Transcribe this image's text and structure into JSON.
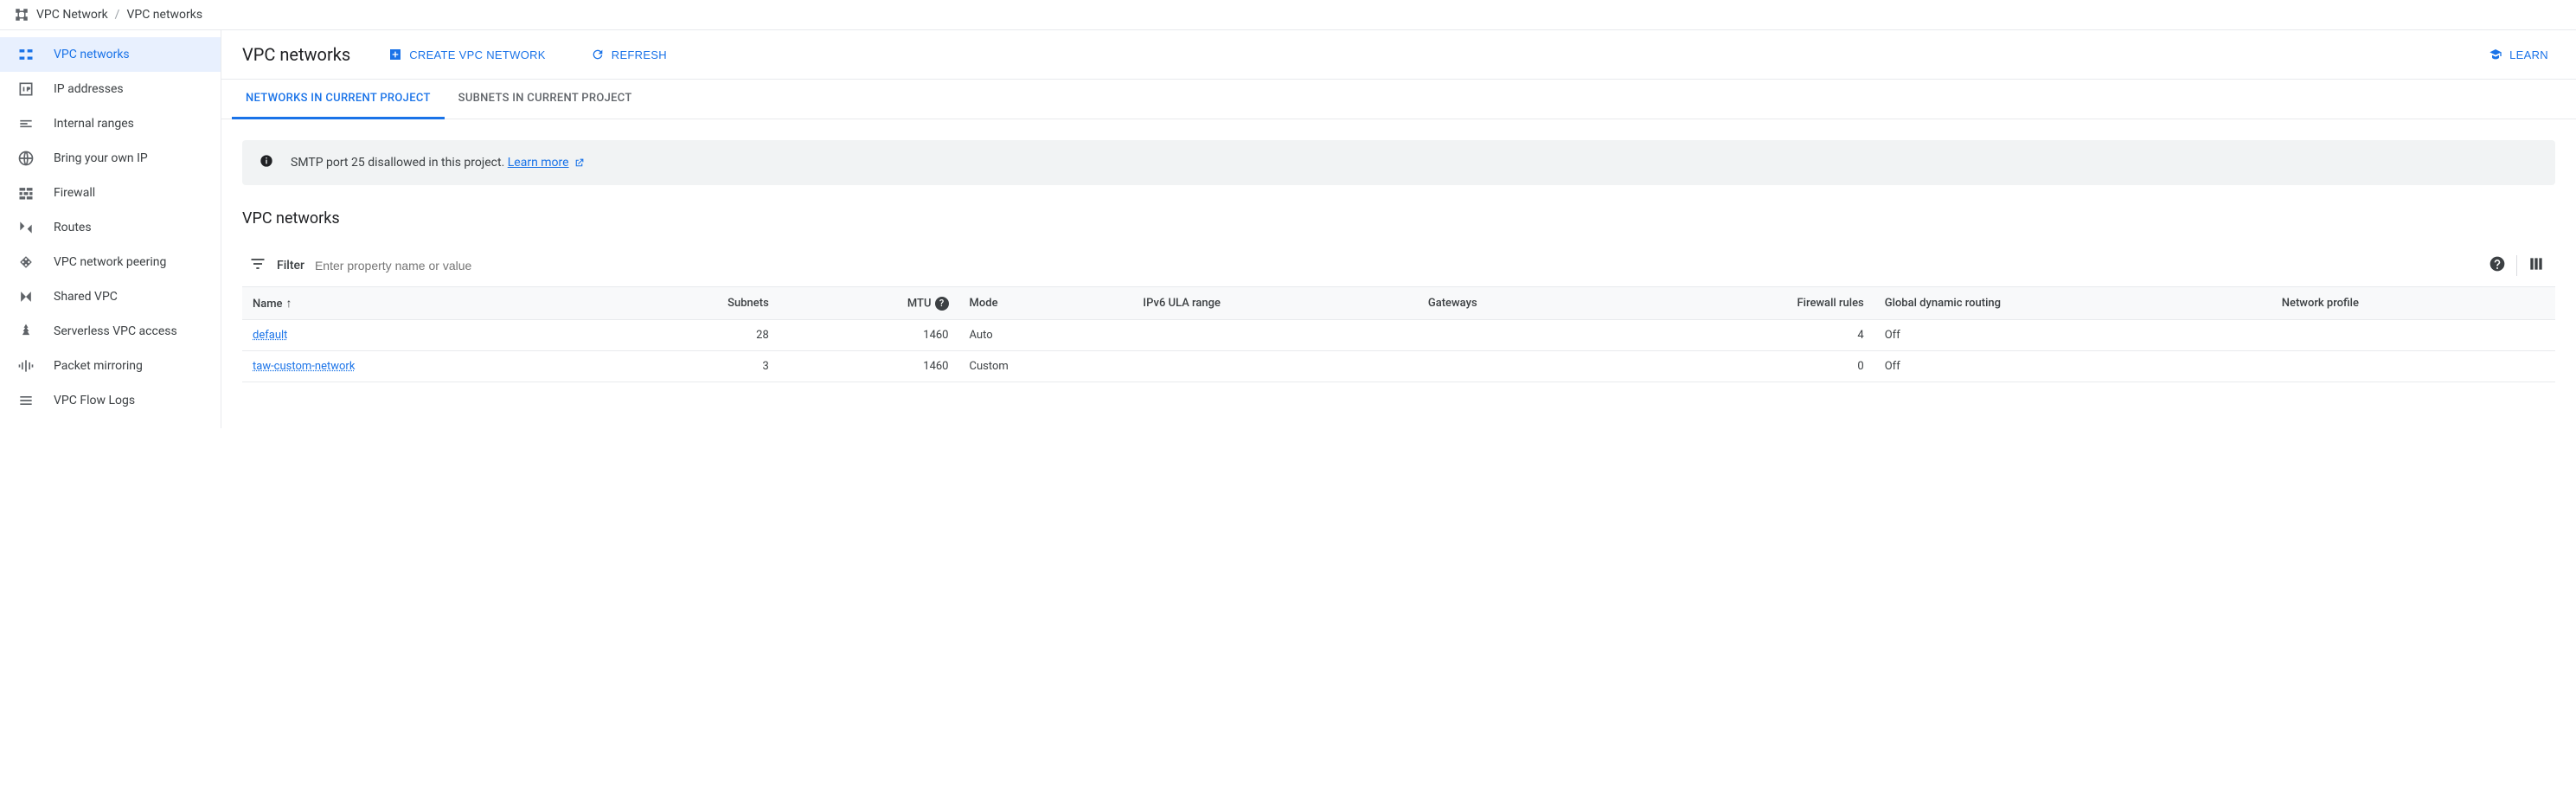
{
  "breadcrumb": {
    "parent": "VPC Network",
    "current": "VPC networks"
  },
  "sidebar": {
    "items": [
      {
        "label": "VPC networks",
        "icon": "vpc-networks-icon",
        "active": true
      },
      {
        "label": "IP addresses",
        "icon": "ip-addresses-icon"
      },
      {
        "label": "Internal ranges",
        "icon": "internal-ranges-icon"
      },
      {
        "label": "Bring your own IP",
        "icon": "globe-icon"
      },
      {
        "label": "Firewall",
        "icon": "firewall-icon"
      },
      {
        "label": "Routes",
        "icon": "routes-icon"
      },
      {
        "label": "VPC network peering",
        "icon": "peering-icon"
      },
      {
        "label": "Shared VPC",
        "icon": "shared-vpc-icon"
      },
      {
        "label": "Serverless VPC access",
        "icon": "serverless-icon"
      },
      {
        "label": "Packet mirroring",
        "icon": "packet-mirroring-icon"
      },
      {
        "label": "VPC Flow Logs",
        "icon": "flow-logs-icon"
      }
    ]
  },
  "header": {
    "title": "VPC networks",
    "create_label": "CREATE VPC NETWORK",
    "refresh_label": "REFRESH",
    "learn_label": "LEARN"
  },
  "tabs": [
    {
      "label": "NETWORKS IN CURRENT PROJECT",
      "active": true
    },
    {
      "label": "SUBNETS IN CURRENT PROJECT"
    }
  ],
  "notice": {
    "text": "SMTP port 25 disallowed in this project. ",
    "link_text": "Learn more"
  },
  "section_title": "VPC networks",
  "filter": {
    "label": "Filter",
    "placeholder": "Enter property name or value"
  },
  "table": {
    "columns": [
      "Name",
      "Subnets",
      "MTU",
      "Mode",
      "IPv6 ULA range",
      "Gateways",
      "Firewall rules",
      "Global dynamic routing",
      "Network profile"
    ],
    "rows": [
      {
        "name": "default",
        "subnets": "28",
        "mtu": "1460",
        "mode": "Auto",
        "ula": "",
        "gateways": "",
        "firewall": "4",
        "gdr": "Off",
        "profile": ""
      },
      {
        "name": "taw-custom-network",
        "subnets": "3",
        "mtu": "1460",
        "mode": "Custom",
        "ula": "",
        "gateways": "",
        "firewall": "0",
        "gdr": "Off",
        "profile": ""
      }
    ]
  }
}
